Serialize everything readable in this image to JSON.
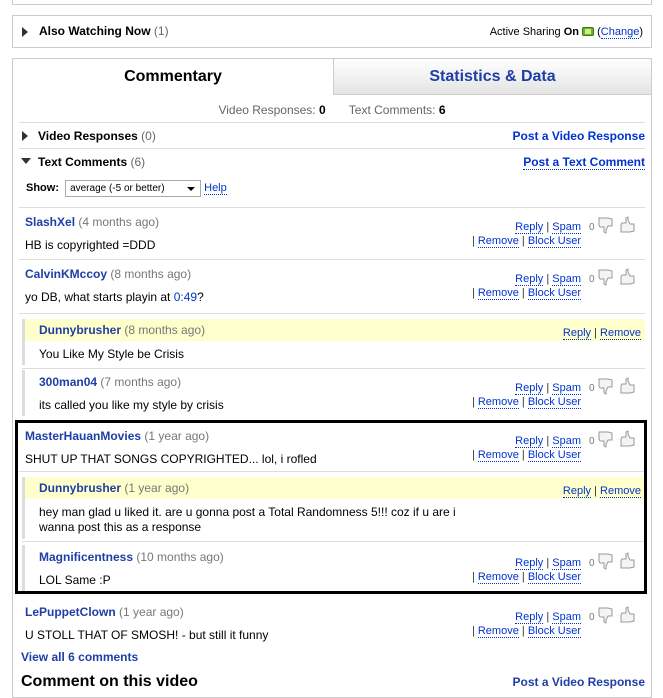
{
  "also_watching": {
    "title": "Also Watching Now",
    "count": "(1)",
    "active_sharing_label": "Active Sharing",
    "active_sharing_state": "On",
    "change_label": "Change"
  },
  "tabs": [
    {
      "label": "Commentary",
      "active": true
    },
    {
      "label": "Statistics & Data",
      "active": false
    }
  ],
  "counts": {
    "video_responses_label": "Video Responses:",
    "video_responses": "0",
    "text_comments_label": "Text Comments:",
    "text_comments": "6"
  },
  "sections": {
    "video_responses": {
      "label": "Video Responses",
      "count": "(0)",
      "action": "Post a Video Response"
    },
    "text_comments": {
      "label": "Text Comments",
      "count": "(6)",
      "action": "Post a Text Comment"
    }
  },
  "filter": {
    "label": "Show:",
    "selected": "average (-5 or better)",
    "help": "Help"
  },
  "actions": {
    "reply": "Reply",
    "spam": "Spam",
    "remove": "Remove",
    "block": "Block User"
  },
  "comments": [
    {
      "author": "SlashXel",
      "time": "(4 months ago)",
      "body": "HB is copyrighted =DDD",
      "score": "0"
    },
    {
      "author": "CalvinKMccoy",
      "time": "(8 months ago)",
      "body": "yo DB, what starts playin at ",
      "link": "0:49",
      "body_end": "?",
      "score": "0"
    },
    {
      "author": "Dunnybrusher",
      "time": "(8 months ago)",
      "body": "You Like My Style be Crisis"
    },
    {
      "author": "300man04",
      "time": "(7 months ago)",
      "body": "its called you like my style by crisis",
      "score": "0"
    },
    {
      "author": "MasterHauanMovies",
      "time": "(1 year ago)",
      "body": "SHUT UP THAT SONGS COPYRIGHTED... lol, i rofled",
      "score": "0"
    },
    {
      "author": "Dunnybrusher",
      "time": "(1 year ago)",
      "body": "hey man glad u liked it. are u gonna post a Total Randomness 5!!! coz if u are i",
      "body2": "wanna post this as a response"
    },
    {
      "author": "Magnificentness",
      "time": "(10 months ago)",
      "body": "LOL Same :P",
      "score": "0"
    },
    {
      "author": "LePuppetClown",
      "time": "(1 year ago)",
      "body": "U STOLL THAT OF SMOSH! - but still it funny",
      "score": "0"
    }
  ],
  "view_all": "View all 6 comments",
  "comment_on_video": "Comment on this video",
  "post_video_response": "Post a Video Response"
}
